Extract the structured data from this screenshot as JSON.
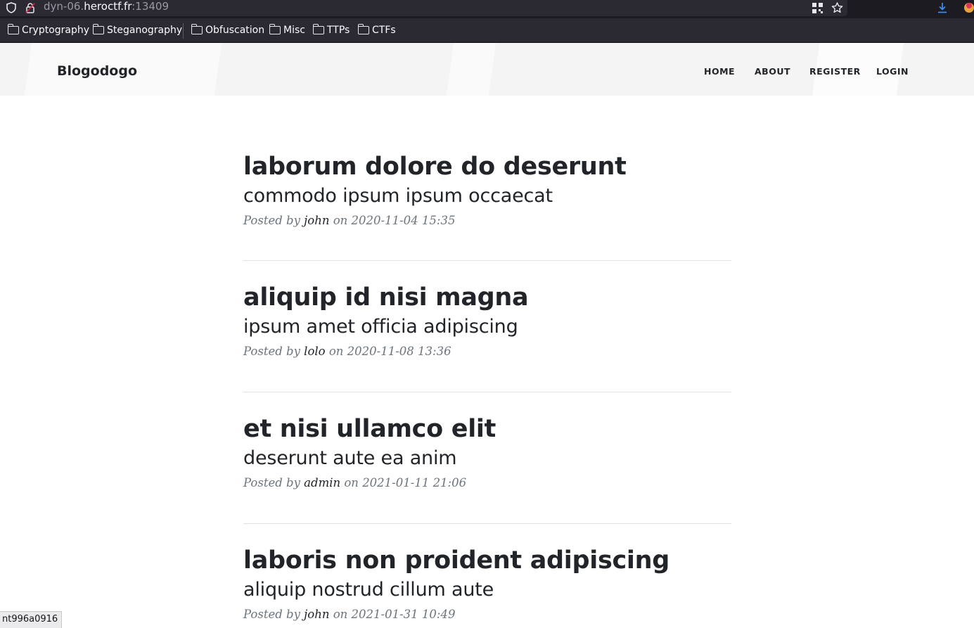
{
  "browser": {
    "url_prefix": "dyn-06.",
    "url_host": "heroctf.fr",
    "url_port": ":13409",
    "bookmarks": [
      {
        "label": "Cryptography"
      },
      {
        "label": "Steganography"
      },
      {
        "label": "Obfuscation"
      },
      {
        "label": "Misc"
      },
      {
        "label": "TTPs"
      },
      {
        "label": "CTFs"
      }
    ],
    "status_text": "nt996a0916"
  },
  "site": {
    "brand": "Blogodogo",
    "nav": [
      {
        "label": "HOME"
      },
      {
        "label": "ABOUT"
      },
      {
        "label": "REGISTER"
      },
      {
        "label": "LOGIN"
      }
    ]
  },
  "posts": [
    {
      "title": "laborum dolore do deserunt",
      "subtitle": "commodo ipsum ipsum occaecat",
      "posted_by": "Posted by",
      "author": "john",
      "on": "on",
      "date": "2020-11-04 15:35"
    },
    {
      "title": "aliquip id nisi magna",
      "subtitle": "ipsum amet officia adipiscing",
      "posted_by": "Posted by",
      "author": "lolo",
      "on": "on",
      "date": "2020-11-08 13:36"
    },
    {
      "title": "et nisi ullamco elit",
      "subtitle": "deserunt aute ea anim",
      "posted_by": "Posted by",
      "author": "admin",
      "on": "on",
      "date": "2021-01-11 21:06"
    },
    {
      "title": "laboris non proident adipiscing",
      "subtitle": "aliquip nostrud cillum aute",
      "posted_by": "Posted by",
      "author": "john",
      "on": "on",
      "date": "2021-01-31 10:49"
    }
  ]
}
